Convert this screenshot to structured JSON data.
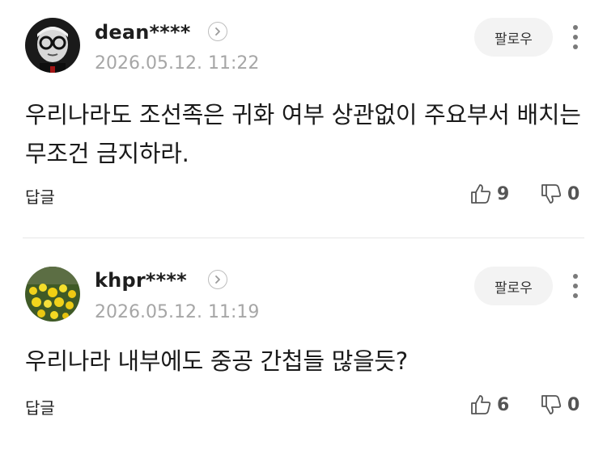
{
  "comments": [
    {
      "username": "dean****",
      "date": "2026.05.12. 11:22",
      "follow_label": "팔로우",
      "text": "우리나라도 조선족은 귀화 여부 상관없이 주요부서 배치는 무조건 금지하라.",
      "reply_label": "답글",
      "likes": "9",
      "dislikes": "0",
      "avatar_icon": "portrait-glasses-man"
    },
    {
      "username": "khpr****",
      "date": "2026.05.12. 11:19",
      "follow_label": "팔로우",
      "text": "우리나라 내부에도 중공 간첩들 많을듯?",
      "reply_label": "답글",
      "likes": "6",
      "dislikes": "0",
      "avatar_icon": "yellow-flowers-photo"
    }
  ],
  "colors": {
    "text": "#1a1a1a",
    "muted": "#a6a6a6",
    "follow_bg": "#f3f3f3",
    "divider": "#e6e6e6"
  }
}
